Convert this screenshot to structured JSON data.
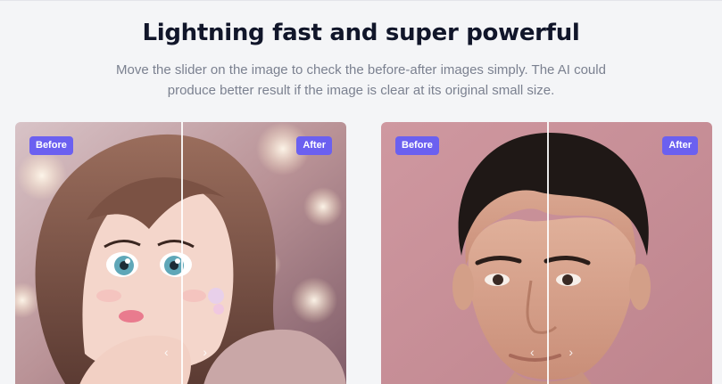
{
  "section": {
    "title": "Lightning fast and super powerful",
    "subtitle": "Move the slider on the image to check the before-after images simply. The AI could produce better result if the image is clear at its original small size."
  },
  "comparisons": [
    {
      "id": "anime",
      "before_label": "Before",
      "after_label": "After",
      "slider_position": 0.5,
      "handle_left": "‹",
      "handle_right": "›"
    },
    {
      "id": "portrait",
      "before_label": "Before",
      "after_label": "After",
      "slider_position": 0.5,
      "handle_left": "‹",
      "handle_right": "›"
    }
  ],
  "colors": {
    "badge": "#6b60f0",
    "title": "#11162a",
    "subtitle": "#7b8190",
    "background": "#f4f5f7"
  }
}
